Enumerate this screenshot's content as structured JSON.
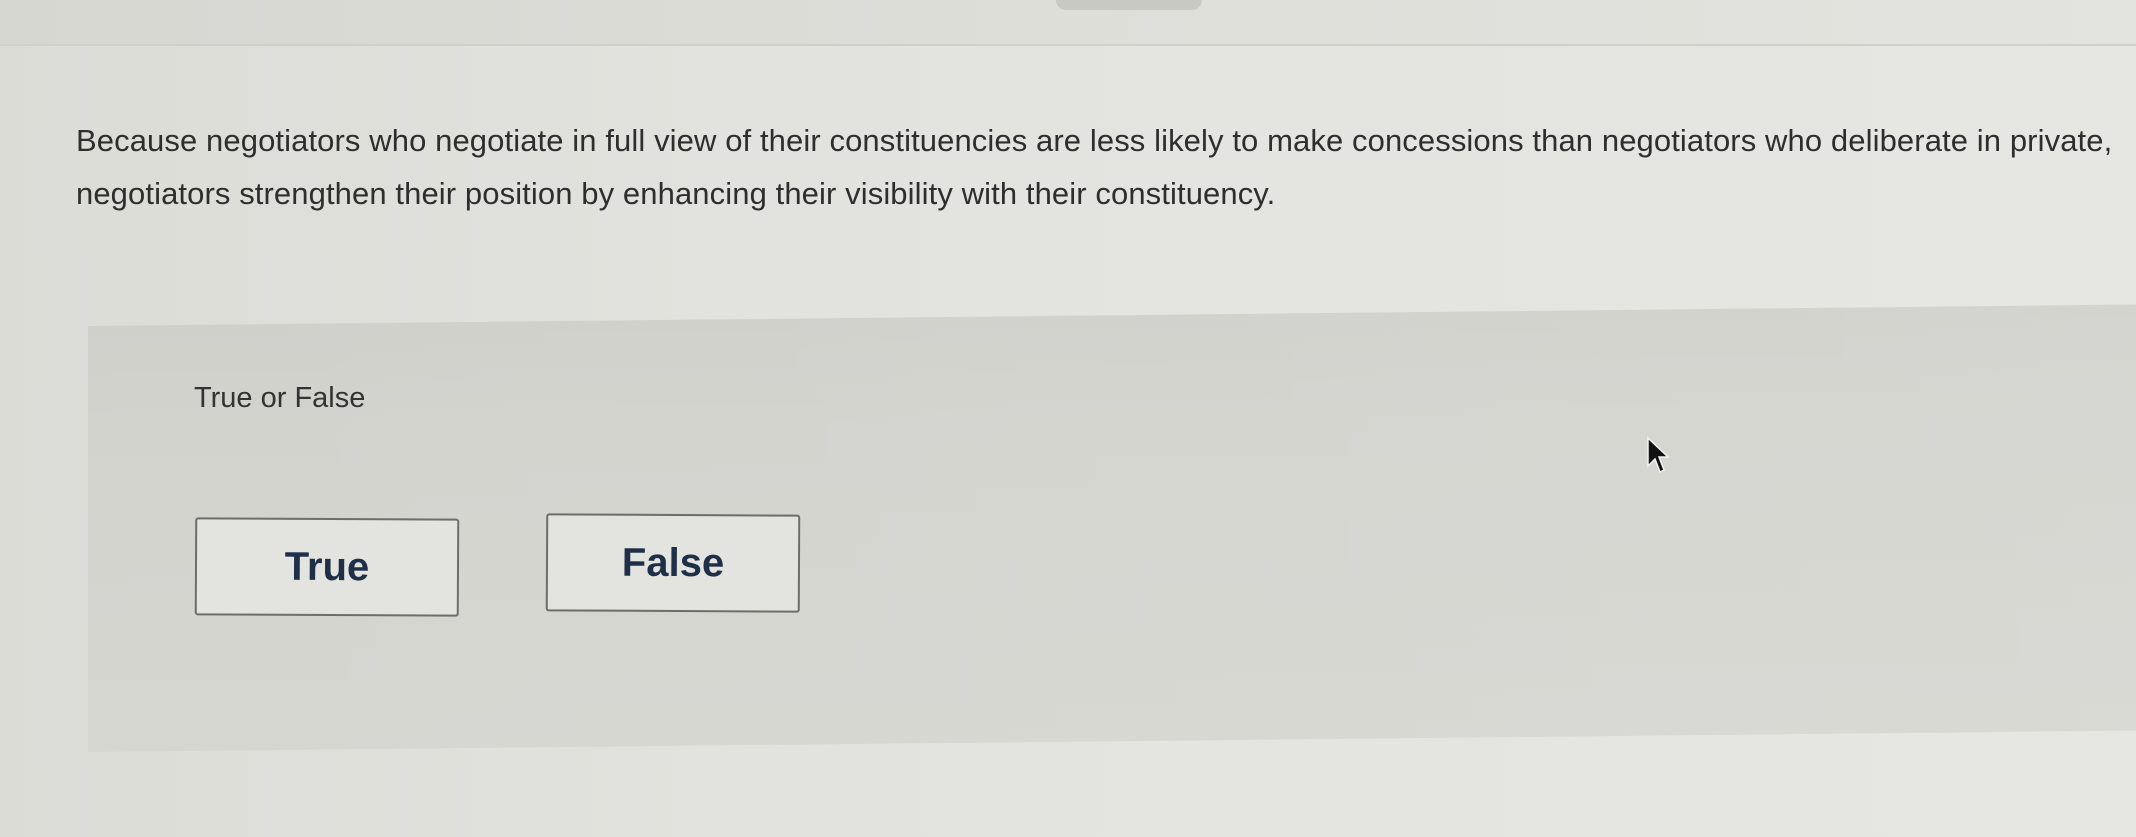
{
  "question": {
    "text": "Because negotiators who negotiate in full view of their constituencies are less likely to make concessions than negotiators who deliberate in private, negotiators strengthen their position by enhancing their visibility with their constituency."
  },
  "answer_panel": {
    "prompt": "True or False",
    "choices": [
      {
        "label": "True"
      },
      {
        "label": "False"
      }
    ]
  },
  "icons": {
    "cursor": "mouse-pointer-icon"
  },
  "colors": {
    "button_text": "#1f2f48",
    "button_border": "#6d6d6b",
    "question_text": "#2e2e2e"
  }
}
